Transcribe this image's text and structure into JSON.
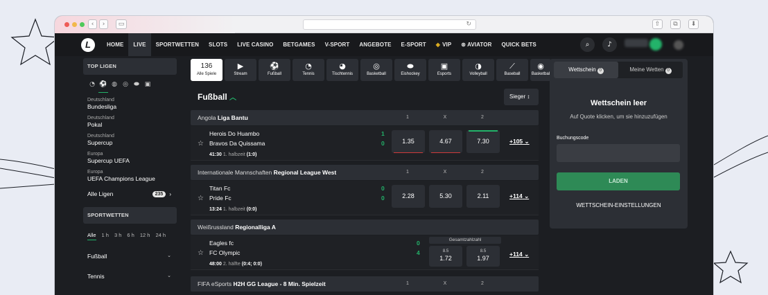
{
  "colors": {
    "accent_green": "#23b36a",
    "panel": "#2c2f35",
    "background": "#1c1e22",
    "odds_down": "#d03a3a"
  },
  "nav": {
    "items": [
      {
        "label": "HOME"
      },
      {
        "label": "LIVE"
      },
      {
        "label": "SPORTWETTEN"
      },
      {
        "label": "SLOTS"
      },
      {
        "label": "LIVE CASINO"
      },
      {
        "label": "BETGAMES"
      },
      {
        "label": "V-SPORT"
      },
      {
        "label": "ANGEBOTE"
      },
      {
        "label": "E-SPORT"
      },
      {
        "label": "VIP",
        "icon": "vip-shield-icon"
      },
      {
        "label": "AVIATOR",
        "icon": "aviator-icon"
      },
      {
        "label": "QUICK BETS"
      }
    ],
    "active": "LIVE"
  },
  "sidebar": {
    "top_title": "TOP LIGEN",
    "sport_icons": [
      "tennis-icon",
      "football-icon",
      "ice-hockey-icon",
      "basketball-icon",
      "table-tennis-icon",
      "esports-icon"
    ],
    "leagues": [
      {
        "country": "Deutschland",
        "name": "Bundesliga"
      },
      {
        "country": "Deutschland",
        "name": "Pokal"
      },
      {
        "country": "Deutschland",
        "name": "Supercup"
      },
      {
        "country": "Europa",
        "name": "Supercup UEFA"
      },
      {
        "country": "Europa",
        "name": "UEFA Champions League"
      }
    ],
    "all_leagues": "Alle Ligen",
    "all_leagues_count": "235",
    "sportwetten_title": "SPORTWETTEN",
    "time_filters": [
      "Alle",
      "1 h",
      "3 h",
      "6 h",
      "12 h",
      "24 h"
    ],
    "sports": [
      "Fußball",
      "Tennis"
    ]
  },
  "sport_tabs": [
    {
      "count": "136",
      "label": "Alle Spiele"
    },
    {
      "icon": "stream-icon",
      "label": "Stream"
    },
    {
      "icon": "football-icon",
      "label": "Fußball"
    },
    {
      "icon": "tennis-icon",
      "label": "Tennis"
    },
    {
      "icon": "table-tennis-icon",
      "label": "Tischtennis"
    },
    {
      "icon": "basketball-icon",
      "label": "Basketball"
    },
    {
      "icon": "ice-hockey-icon",
      "label": "Eishockey"
    },
    {
      "icon": "esports-icon",
      "label": "Esports"
    },
    {
      "icon": "volleyball-icon",
      "label": "Volleyball"
    },
    {
      "icon": "baseball-icon",
      "label": "Baseball"
    },
    {
      "icon": "basketball-3x3-icon",
      "label": "Basketbal"
    }
  ],
  "section": {
    "title": "Fußball",
    "sort": "Sieger"
  },
  "cols": [
    "1",
    "X",
    "2"
  ],
  "groups": [
    {
      "country": "Angola",
      "league": "Liga Bantu",
      "match": {
        "home": "Herois Do Huambo",
        "away": "Bravos Da Quissama",
        "home_score": "1",
        "away_score": "0",
        "time": "41:30",
        "period": "1. halbzeit",
        "period_score": "(1:0)",
        "odds": [
          "1.35",
          "4.67",
          "7.30"
        ],
        "more": "+105"
      }
    },
    {
      "country": "Internationale Mannschaften",
      "league": "Regional League West",
      "match": {
        "home": "Titan Fc",
        "away": "Pride Fc",
        "home_score": "0",
        "away_score": "0",
        "time": "13:24",
        "period": "1. halbzeit",
        "period_score": "(0:0)",
        "odds": [
          "2.28",
          "5.30",
          "2.11"
        ],
        "more": "+114"
      }
    },
    {
      "country": "Weißrussland",
      "league": "Regionalliga A",
      "match": {
        "home": "Eagles fc",
        "away": "FC Olympic",
        "home_score": "0",
        "away_score": "4",
        "time": "48:00",
        "period": "2. hälfte",
        "period_score": "(0:4; 0:0)",
        "market": "Gesamtzahlzahl",
        "handicaps": [
          "8.5",
          "8.5"
        ],
        "odds": [
          "1.72",
          "1.97"
        ],
        "more": "+114"
      }
    },
    {
      "country": "FIFA eSports",
      "league": "H2H GG League - 8 Min. Spielzeit"
    }
  ],
  "betslip": {
    "tab_betslip": "Wettschein",
    "tab_betslip_count": "0",
    "tab_mybets": "Meine Wetten",
    "tab_mybets_count": "0",
    "empty_title": "Wettschein leer",
    "empty_sub": "Auf Quote klicken, um sie hinzuzufügen",
    "code_label": "Buchungscode",
    "load_button": "LADEN",
    "settings": "WETTSCHEIN-EINSTELLUNGEN"
  }
}
